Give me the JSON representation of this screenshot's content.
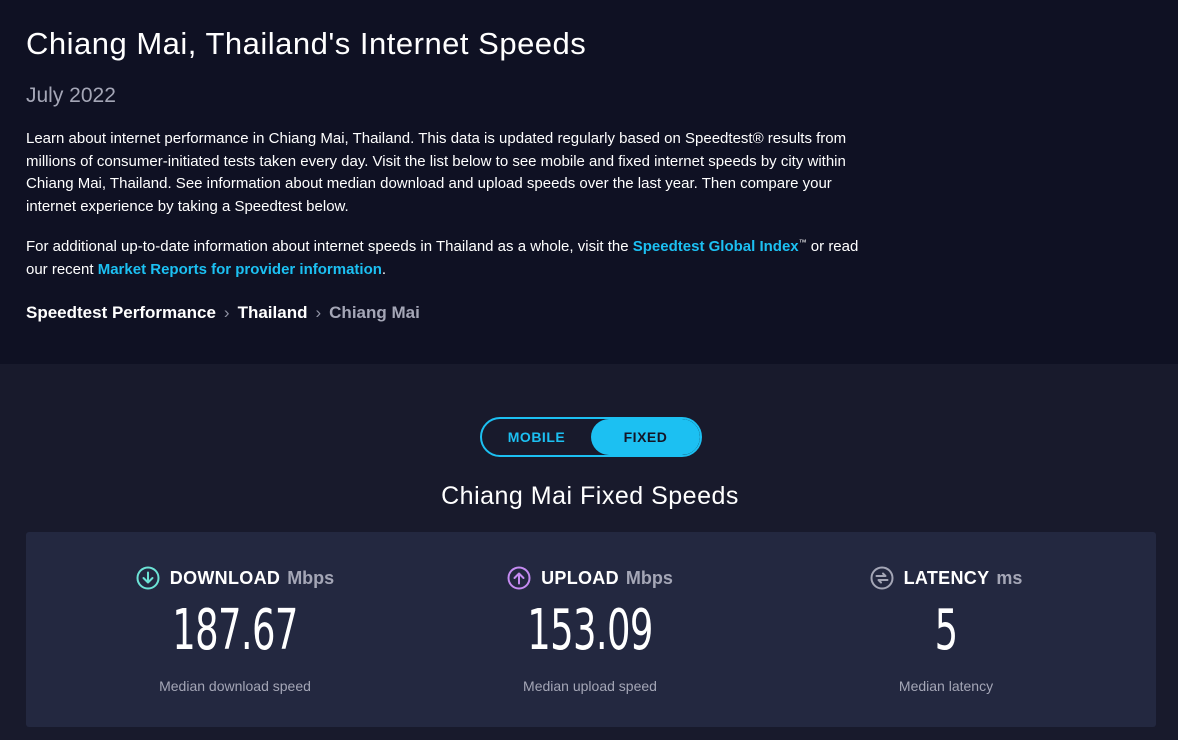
{
  "header": {
    "title": "Chiang Mai, Thailand's Internet Speeds",
    "date": "July 2022",
    "intro": "Learn about internet performance in Chiang Mai, Thailand. This data is updated regularly based on Speedtest® results from millions of consumer-initiated tests taken every day. Visit the list below to see mobile and fixed internet speeds by city within Chiang Mai, Thailand. See information about median download and upload speeds over the last year. Then compare your internet experience by taking a Speedtest below.",
    "more_prefix": "For additional up-to-date information about internet speeds in Thailand as a whole, visit the ",
    "global_index_link": "Speedtest Global Index",
    "tm": "™",
    "more_middle": " or read our recent ",
    "market_reports_link": "Market Reports for provider information",
    "more_suffix": "."
  },
  "breadcrumb": {
    "items": [
      "Speedtest Performance",
      "Thailand"
    ],
    "current": "Chiang Mai",
    "separator": "›"
  },
  "toggle": {
    "mobile_label": "MOBILE",
    "fixed_label": "FIXED",
    "selected": "FIXED"
  },
  "section": {
    "title": "Chiang Mai Fixed Speeds"
  },
  "stats": {
    "download": {
      "label": "DOWNLOAD",
      "unit": "Mbps",
      "value": "187.67",
      "caption": "Median download speed",
      "icon": "download-arrow-icon",
      "color": "#6ce3d6"
    },
    "upload": {
      "label": "UPLOAD",
      "unit": "Mbps",
      "value": "153.09",
      "caption": "Median upload speed",
      "icon": "upload-arrow-icon",
      "color": "#c58bf2"
    },
    "latency": {
      "label": "LATENCY",
      "unit": "ms",
      "value": "5",
      "caption": "Median latency",
      "icon": "latency-icon",
      "color": "#a4a6b6"
    }
  },
  "colors": {
    "accent": "#1cc0f2",
    "header_bg": "#0f1123",
    "body_bg": "#181a2c",
    "card_bg": "#232840"
  }
}
